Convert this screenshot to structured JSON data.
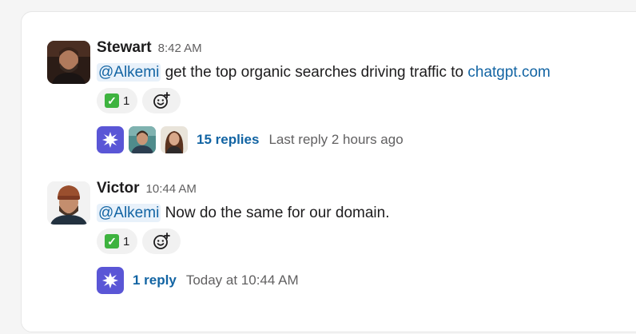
{
  "messages": [
    {
      "author": "Stewart",
      "time": "8:42 AM",
      "mention": "@Alkemi",
      "text": " get the top organic searches driving traffic to ",
      "link": "chatgpt.com",
      "reaction": {
        "emoji": "✅",
        "count": "1"
      },
      "thread": {
        "replies": "15 replies",
        "last_reply": "Last reply 2 hours ago"
      }
    },
    {
      "author": "Victor",
      "time": "10:44 AM",
      "mention": "@Alkemi",
      "text": " Now do the same for our domain.",
      "reaction": {
        "emoji": "✅",
        "count": "1"
      },
      "thread": {
        "replies": "1 reply",
        "last_reply": "Today at 10:44 AM"
      }
    }
  ],
  "icons": {
    "reaction": "check-mark-emoji-icon",
    "add_reaction": "add-reaction-icon",
    "bot": "alkemi-bot-icon"
  },
  "colors": {
    "link": "#1264a3",
    "mention_bg": "#e8f1fa",
    "bot": "#5a56d6",
    "check": "#3eb33f"
  }
}
